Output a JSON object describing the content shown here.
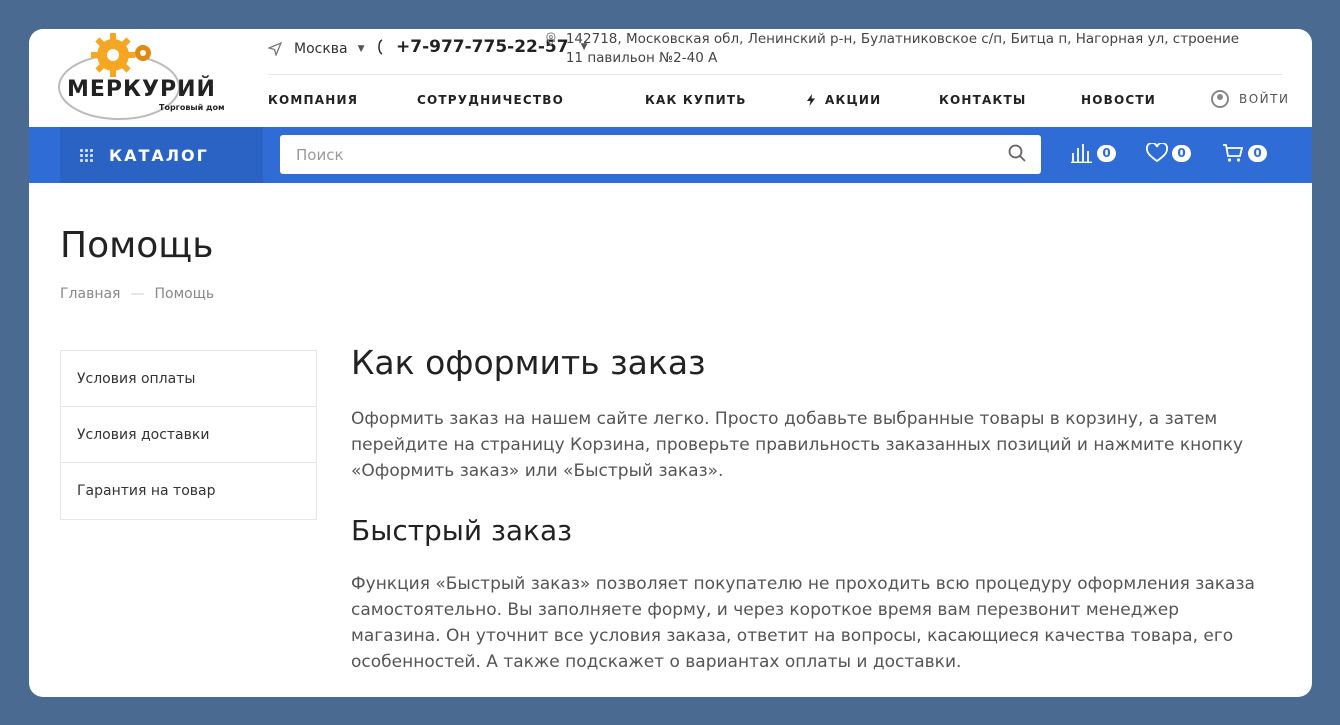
{
  "logo": {
    "brand": "МЕРКУРИЙ",
    "sub": "Торговый дом"
  },
  "topbar": {
    "city": "Москва",
    "phone": "+7-977-775-22-57",
    "address": "142718, Московская обл, Ленинский р-н, Булатниковское с/п, Битца п, Нагорная ул, строение 11 павильон №2-40 А"
  },
  "nav": {
    "items": [
      "КОМПАНИЯ",
      "СОТРУДНИЧЕСТВО",
      "КАК КУПИТЬ",
      "АКЦИИ",
      "КОНТАКТЫ",
      "НОВОСТИ"
    ],
    "login": "ВОЙТИ"
  },
  "bar": {
    "catalog": "КАТАЛОГ",
    "search_placeholder": "Поиск",
    "compare_count": "0",
    "favorites_count": "0",
    "cart_count": "0"
  },
  "page": {
    "title": "Помощь",
    "breadcrumb": [
      "Главная",
      "Помощь"
    ]
  },
  "sidebar": {
    "items": [
      "Условия оплаты",
      "Условия доставки",
      "Гарантия на товар"
    ]
  },
  "content": {
    "h1": "Как оформить заказ",
    "p1": "Оформить заказ на нашем сайте легко. Просто добавьте выбранные товары в корзину, а затем перейдите на страницу Корзина, проверьте правильность заказанных позиций и нажмите кнопку «Оформить заказ» или «Быстрый заказ».",
    "h2": "Быстрый заказ",
    "p2": "Функция «Быстрый заказ» позволяет покупателю не проходить всю процедуру оформления заказа самостоятельно. Вы заполняете форму, и через короткое время вам перезвонит менеджер магазина. Он уточнит все условия заказа, ответит на вопросы, касающиеся качества товара, его особенностей. А также подскажет о вариантах оплаты и доставки."
  },
  "colors": {
    "background": "#4a6a92",
    "accent": "#2f6cd6",
    "logo_gear": "#f5a623"
  },
  "icons": [
    "gear-logo-icon",
    "send-icon",
    "phone-icon",
    "map-pin-icon",
    "lightning-icon",
    "user-icon",
    "grid-icon",
    "search-icon",
    "compare-icon",
    "heart-icon",
    "cart-icon"
  ]
}
